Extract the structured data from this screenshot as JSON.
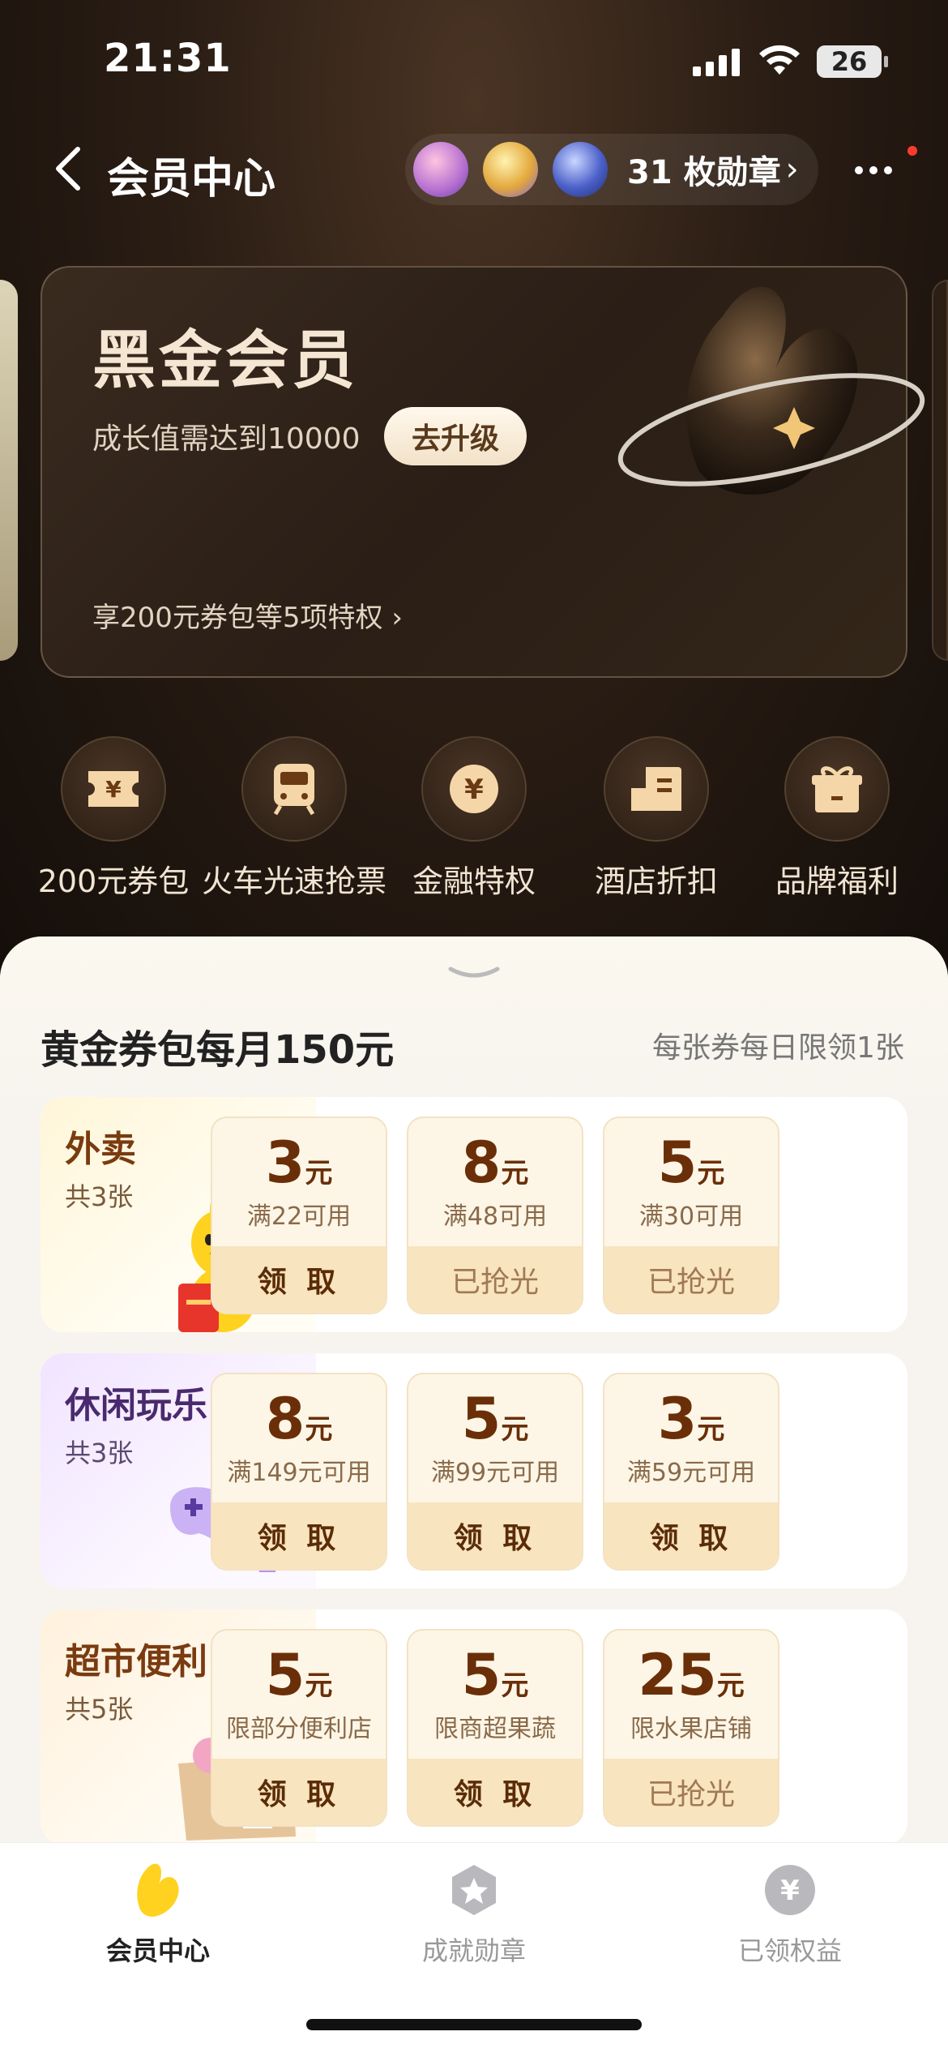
{
  "status_bar": {
    "time": "21:31",
    "battery": "26"
  },
  "header": {
    "title": "会员中心",
    "medal_count": "31 枚勋章",
    "medal_chevron": "›"
  },
  "member_card": {
    "title": "黑金会员",
    "growth_requirement": "成长值需达到10000",
    "upgrade_label": "去升级",
    "privileges_link": "享200元券包等5项特权 ›"
  },
  "quick_actions": [
    {
      "label": "200元券包",
      "icon": "ticket-icon"
    },
    {
      "label": "火车光速抢票",
      "icon": "train-icon"
    },
    {
      "label": "金融特权",
      "icon": "yen-coin-icon"
    },
    {
      "label": "酒店折扣",
      "icon": "hotel-icon"
    },
    {
      "label": "品牌福利",
      "icon": "gift-icon"
    }
  ],
  "coupon_section": {
    "title": "黄金券包每月150元",
    "note": "每张券每日限领1张",
    "groups": [
      {
        "name": "外卖",
        "count": "共3张",
        "coupons": [
          {
            "amount": "3",
            "unit": "元",
            "condition": "满22可用",
            "action": "领 取",
            "claimed_out": false
          },
          {
            "amount": "8",
            "unit": "元",
            "condition": "满48可用",
            "action": "已抢光",
            "claimed_out": true
          },
          {
            "amount": "5",
            "unit": "元",
            "condition": "满30可用",
            "action": "已抢光",
            "claimed_out": true
          }
        ]
      },
      {
        "name": "休闲玩乐",
        "count": "共3张",
        "coupons": [
          {
            "amount": "8",
            "unit": "元",
            "condition": "满149元可用",
            "action": "领 取",
            "claimed_out": false
          },
          {
            "amount": "5",
            "unit": "元",
            "condition": "满99元可用",
            "action": "领 取",
            "claimed_out": false
          },
          {
            "amount": "3",
            "unit": "元",
            "condition": "满59元可用",
            "action": "领 取",
            "claimed_out": false
          }
        ]
      },
      {
        "name": "超市便利",
        "count": "共5张",
        "coupons": [
          {
            "amount": "5",
            "unit": "元",
            "condition": "限部分便利店",
            "action": "领 取",
            "claimed_out": false
          },
          {
            "amount": "5",
            "unit": "元",
            "condition": "限商超果蔬",
            "action": "领 取",
            "claimed_out": false
          },
          {
            "amount": "25",
            "unit": "元",
            "condition": "限水果店铺",
            "action": "已抢光",
            "claimed_out": true
          }
        ]
      }
    ]
  },
  "tab_bar": [
    {
      "label": "会员中心",
      "active": true
    },
    {
      "label": "成就勋章",
      "active": false
    },
    {
      "label": "已领权益",
      "active": false
    }
  ],
  "colors": {
    "accent_gold": "#f8e4bf",
    "coupon_text": "#6a2f08",
    "dark_bg": "#1a120d",
    "active_tab_icon": "#ffd21f"
  }
}
